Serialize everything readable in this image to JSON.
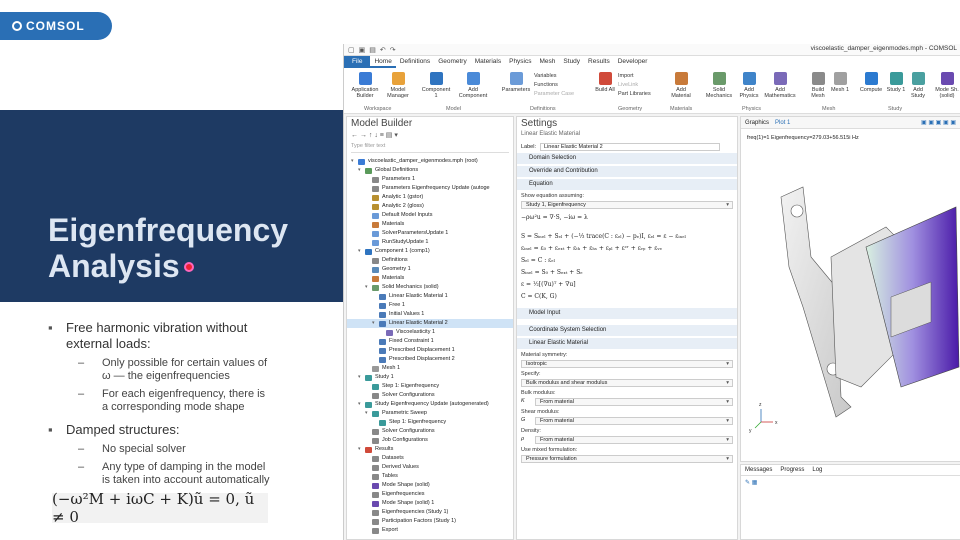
{
  "logo": {
    "text": "COMSOL"
  },
  "slide": {
    "title_line1": "Eigenfrequency",
    "title_line2": "Analysis",
    "bullets": [
      {
        "text": "Free harmonic vibration without external loads:",
        "subs": [
          "Only possible for certain values of ω — the eigenfrequencies",
          "For each eigenfrequency, there is a corresponding mode shape"
        ]
      },
      {
        "text": "Damped structures:",
        "subs": [
          "No special solver",
          "Any type of damping in the model is taken into account automatically"
        ]
      }
    ],
    "formula": "(−ω²M + iωC + K)ũ = 0, ũ ≠ 0"
  },
  "app": {
    "window_title": "viscoelastic_damper_eigenmodes.mph - COMSOL",
    "menu": [
      "File",
      "Home",
      "Definitions",
      "Geometry",
      "Materials",
      "Physics",
      "Mesh",
      "Study",
      "Results",
      "Developer"
    ],
    "ribbon": {
      "buttons": [
        "Application Builder",
        "Model Manager",
        "Component 1",
        "Add Component",
        "Parameters",
        "Build All",
        "Add Material",
        "Solid Mechanics",
        "Add Physics",
        "Add Mathematics",
        "Build Mesh",
        "Mesh 1",
        "Compute",
        "Study 1",
        "Add Study",
        "Mode Sh. (solid)"
      ],
      "small": [
        "Variables",
        "Functions",
        "Parameter Case",
        "Import",
        "LiveLink",
        "Part Libraries"
      ],
      "groups": [
        "Workspace",
        "Model",
        "Definitions",
        "Geometry",
        "Materials",
        "Physics",
        "Mesh",
        "Study"
      ]
    },
    "model_builder": {
      "title": "Model Builder",
      "filter_placeholder": "Type filter text",
      "tree": [
        "viscoelastic_damper_eigenmodes.mph (root)",
        "Global Definitions",
        "Parameters 1",
        "Parameters Eigenfrequency Update (autoge",
        "Analytic 1 (gstor)",
        "Analytic 2 (gloss)",
        "Default Model Inputs",
        "Materials",
        "SolverParametersUpdate 1",
        "RunStudyUpdate 1",
        "Component 1 (comp1)",
        "Definitions",
        "Geometry 1",
        "Materials",
        "Solid Mechanics (solid)",
        "Linear Elastic Material 1",
        "Free 1",
        "Initial Values 1",
        "Linear Elastic Material 2",
        "Viscoelasticity 1",
        "Fixed Constraint 1",
        "Prescribed Displacement 1",
        "Prescribed Displacement 2",
        "Mesh 1",
        "Study 1",
        "Step 1: Eigenfrequency",
        "Solver Configurations",
        "Study Eigenfrequency Update (autogenerated)",
        "Parametric Sweep",
        "Step 1: Eigenfrequency",
        "Solver Configurations",
        "Job Configurations",
        "Results",
        "Datasets",
        "Derived Values",
        "Tables",
        "Mode Shape (solid)",
        "Eigenfrequencies",
        "Mode Shape (solid) 1",
        "Eigenfrequencies (Study 1)",
        "Participation Factors (Study 1)",
        "Export"
      ]
    },
    "settings": {
      "title": "Settings",
      "subtitle": "Linear Elastic Material",
      "label_caption": "Label:",
      "label_value": "Linear Elastic Material 2",
      "sections": [
        "Domain Selection",
        "Override and Contribution",
        "Equation",
        "Model Input",
        "Coordinate System Selection",
        "Linear Elastic Material"
      ],
      "show_eq_label": "Show equation assuming:",
      "show_eq_value": "Study 1, Eigenfrequency",
      "eq_lines": [
        "−ρω²u = ∇·S,   −iω = λ",
        "S = Sᵢₙₑₗ + Sₑₗ + (−⅓ trace(C : εₑₗ) − pₑ)I,  εₑₗ = ε − εᵢₙₑₗ",
        "εᵢₙₑₗ = ε₀ + εₑₓₜ + εₜₕ + εₕₛ + εₚₗ + εᶜʳ + εᵥₚ + εᵥₑ",
        "Sₑₗ = C : εₑₗ",
        "Sᵢₙₑₗ = S₀ + Sₑₓₜ + Sₑ",
        "ε = ½[(∇u)ᵀ + ∇u]",
        "C = C(K, G)"
      ],
      "material_symmetry_label": "Material symmetry:",
      "material_symmetry": "Isotropic",
      "specify_label": "Specify:",
      "specify": "Bulk modulus and shear modulus",
      "bulk_label": "Bulk modulus:",
      "bulk_sym": "K",
      "bulk_value": "From material",
      "shear_label": "Shear modulus:",
      "shear_sym": "G",
      "shear_value": "From material",
      "density_label": "Density:",
      "density_sym": "ρ",
      "density_value": "From material",
      "mixed_label": "Use mixed formulation:",
      "mixed_value": "Pressure formulation"
    },
    "graphics": {
      "tabs": [
        "Graphics",
        "Plot 1"
      ],
      "caption": "freq(1)=1 Eigenfrequency=279.03+56.515i Hz"
    },
    "messages": {
      "tabs": [
        "Messages",
        "Progress",
        "Log"
      ]
    }
  }
}
